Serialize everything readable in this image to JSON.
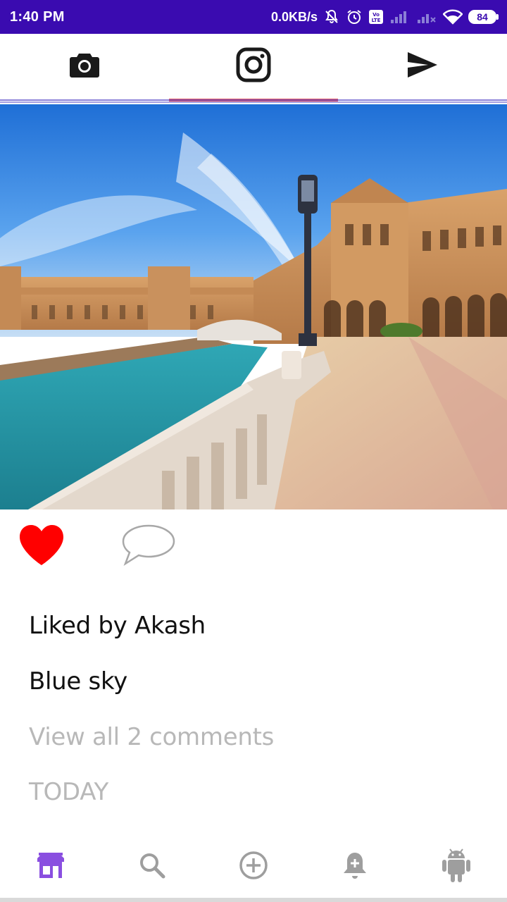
{
  "status_bar": {
    "time": "1:40 PM",
    "network_speed": "0.0KB/s",
    "battery_level": "84",
    "icons": [
      "mute-alarm-icon",
      "alarm-clock-icon",
      "volte-icon",
      "signal-icon",
      "signal-no-service-icon",
      "wifi-icon",
      "battery-icon"
    ]
  },
  "top_tabs": [
    {
      "icon": "camera-icon",
      "active": false
    },
    {
      "icon": "instagram-icon",
      "active": true
    },
    {
      "icon": "send-icon",
      "active": false
    }
  ],
  "post": {
    "image": "plaza-de-espana-photo",
    "liked": true,
    "liked_by": "Liked by Akash",
    "caption": "Blue sky",
    "view_comments": "View all 2 comments",
    "date": "TODAY"
  },
  "bottom_nav": [
    {
      "icon": "store-icon",
      "active": true
    },
    {
      "icon": "search-icon",
      "active": false
    },
    {
      "icon": "add-circle-icon",
      "active": false
    },
    {
      "icon": "notification-add-icon",
      "active": false
    },
    {
      "icon": "android-icon",
      "active": false
    }
  ],
  "colors": {
    "status_bar": "#3a0bb0",
    "active_tab_indicator": "#e05060",
    "like_red": "#ff0000",
    "nav_active": "#8a4fe0",
    "nav_inactive": "#9e9e9e",
    "secondary_text": "#b8b8b8"
  }
}
